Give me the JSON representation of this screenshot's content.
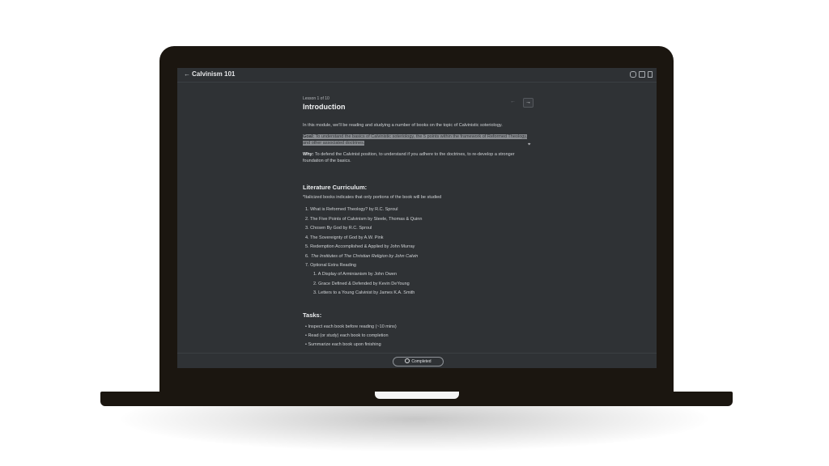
{
  "header": {
    "back_icon": "←",
    "title": "Calvinism 101",
    "icons": [
      "comment-icon",
      "layout-icon",
      "bookmark-icon"
    ]
  },
  "lesson": {
    "label": "Lesson 1 of 10",
    "title": "Introduction",
    "prev_icon": "←",
    "next_icon": "→",
    "intro": "In this module, we'll be reading and studying a number of books on the topic of Calvinistic soteriology.",
    "goal_label": "Goal:",
    "goal_text": " To understand the basics of Calvinistic soteriology, the 5 points within the framework of Reformed Theology, and other associated doctrines.",
    "why_label": "Why:",
    "why_text": " To defend the Calvinist position, to understand if you adhere to the doctrines, to re-develop a stronger foundation of the basics."
  },
  "curriculum": {
    "heading": "Literature Curriculum:",
    "note": "*Italicized books indicates that only portions of the book will be studied",
    "items": [
      "1. What is Reformed Theology? by R.C. Sproul",
      "2. The Five Points of Calvinism by Steele, Thomas & Quinn",
      "3. Chosen By God by R.C. Sproul",
      "4. The Sovereignty of God by A.W. Pink",
      "5. Redemption Accomplished & Applied by John Murray",
      "The Institutes of The Christian Religion by John Calvin",
      "7. Optional Extra Reading"
    ],
    "item6_number": "6.",
    "subitems": [
      "1. A Display of Arminianism by John Owen",
      "2. Grace Defined & Defended by Kevin DeYoung",
      "3. Letters to a Young Calvinist by James K.A. Smith"
    ]
  },
  "tasks": {
    "heading": "Tasks:",
    "items": [
      "• Inspect each book before reading (~10 mins)",
      "• Read (or study) each book to completion",
      "• Summarize each book upon finishing"
    ]
  },
  "footer": {
    "completed_label": "Completed"
  }
}
